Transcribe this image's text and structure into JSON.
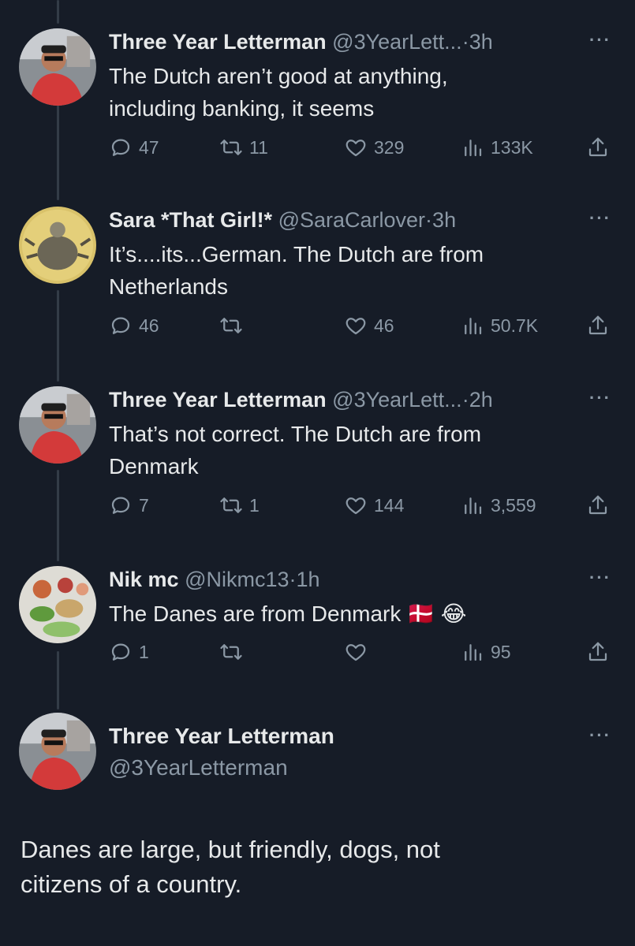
{
  "colors": {
    "background": "#161c27",
    "text": "#e7e9ea",
    "muted": "#8b98a5",
    "thread_line": "#333c47"
  },
  "tweets": [
    {
      "name": "Three Year Letterman",
      "handle": "@3YearLett...",
      "dot": "·",
      "time": "3h",
      "more": "···",
      "text_lines": [
        "The Dutch aren’t good at anything,",
        "including banking, it seems"
      ],
      "replies": "47",
      "retweets": "11",
      "likes": "329",
      "views": "133K"
    },
    {
      "name": "Sara *That Girl!*",
      "handle": "@SaraCarlover",
      "dot": "·",
      "time": "3h",
      "more": "···",
      "text_lines": [
        "It’s....its...German. The Dutch are from",
        "Netherlands"
      ],
      "replies": "46",
      "retweets": "",
      "likes": "46",
      "views": "50.7K"
    },
    {
      "name": "Three Year Letterman",
      "handle": "@3YearLett...",
      "dot": "·",
      "time": "2h",
      "more": "···",
      "text_lines": [
        "That’s not correct. The Dutch are from",
        "Denmark"
      ],
      "replies": "7",
      "retweets": "1",
      "likes": "144",
      "views": "3,559"
    },
    {
      "name": "Nik mc",
      "handle": "@Nikmc13",
      "dot": "·",
      "time": "1h",
      "more": "···",
      "text_lines": [
        "The Danes are from Denmark"
      ],
      "emoji_flag": "🇩🇰",
      "emoji_laugh": "😂",
      "replies": "1",
      "retweets": "",
      "likes": "",
      "views": "95"
    }
  ],
  "main_tweet": {
    "name": "Three Year Letterman",
    "handle": "@3YearLetterman",
    "more": "···",
    "text_lines": [
      "Danes are large, but friendly, dogs, not",
      "citizens of a country."
    ]
  },
  "icons": {
    "reply": "reply-icon",
    "retweet": "retweet-icon",
    "like": "heart-icon",
    "views": "views-icon",
    "share": "share-icon"
  }
}
